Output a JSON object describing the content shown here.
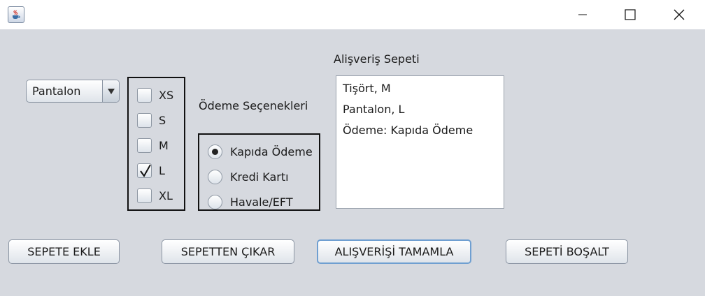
{
  "window": {
    "icon": "java-cup-icon",
    "controls": [
      "minimize-icon",
      "maximize-icon",
      "close-icon"
    ]
  },
  "product_combo": {
    "selected": "Pantalon"
  },
  "sizes": [
    {
      "label": "XS",
      "checked": false
    },
    {
      "label": "S",
      "checked": false
    },
    {
      "label": "M",
      "checked": false
    },
    {
      "label": "L",
      "checked": true
    },
    {
      "label": "XL",
      "checked": false
    }
  ],
  "payment": {
    "title": "Ödeme Seçenekleri",
    "options": [
      {
        "label": "Kapıda Ödeme",
        "selected": true
      },
      {
        "label": "Kredi Kartı",
        "selected": false
      },
      {
        "label": "Havale/EFT",
        "selected": false
      }
    ]
  },
  "cart": {
    "title": "Alişveriş Sepeti",
    "items": [
      "Tişört, M",
      "Pantalon, L",
      "Ödeme: Kapıda Ödeme"
    ]
  },
  "buttons": {
    "add": "SEPETE EKLE",
    "remove": "SEPETTEN ÇIKAR",
    "complete": "ALIŞVERİŞİ TAMAMLA",
    "clear": "SEPETİ BOŞALT"
  }
}
